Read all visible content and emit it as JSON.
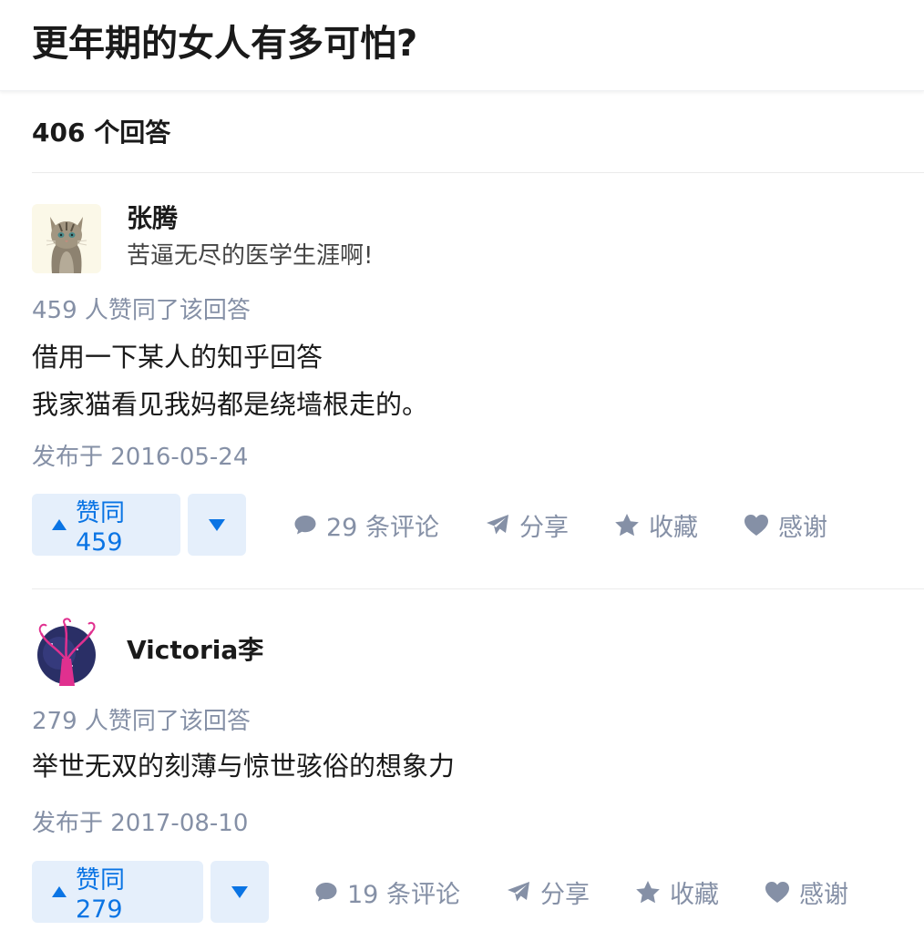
{
  "question": {
    "title": "更年期的女人有多可怕?",
    "answer_count_label": "406 个回答"
  },
  "answers": [
    {
      "author": {
        "name": "张腾",
        "bio": "苦逼无尽的医学生涯啊!",
        "avatar_icon": "cat-avatar-icon"
      },
      "vote_summary": "459 人赞同了该回答",
      "content": [
        "借用一下某人的知乎回答",
        "我家猫看见我妈都是绕墙根走的。"
      ],
      "published": "发布于 2016-05-24",
      "actions": {
        "upvote": "赞同 459",
        "comment": "29 条评论",
        "share": "分享",
        "favorite": "收藏",
        "thanks": "感谢"
      }
    },
    {
      "author": {
        "name": "Victoria李",
        "bio": "",
        "avatar_icon": "tree-avatar-icon"
      },
      "vote_summary": "279 人赞同了该回答",
      "content": [
        "举世无双的刻薄与惊世骇俗的想象力"
      ],
      "published": "发布于 2017-08-10",
      "actions": {
        "upvote": "赞同 279",
        "comment": "19 条评论",
        "share": "分享",
        "favorite": "收藏",
        "thanks": "感谢"
      }
    }
  ],
  "colors": {
    "accent": "#0a74e4",
    "vote_button_bg": "#e5effb",
    "meta_text": "#8590a6"
  }
}
